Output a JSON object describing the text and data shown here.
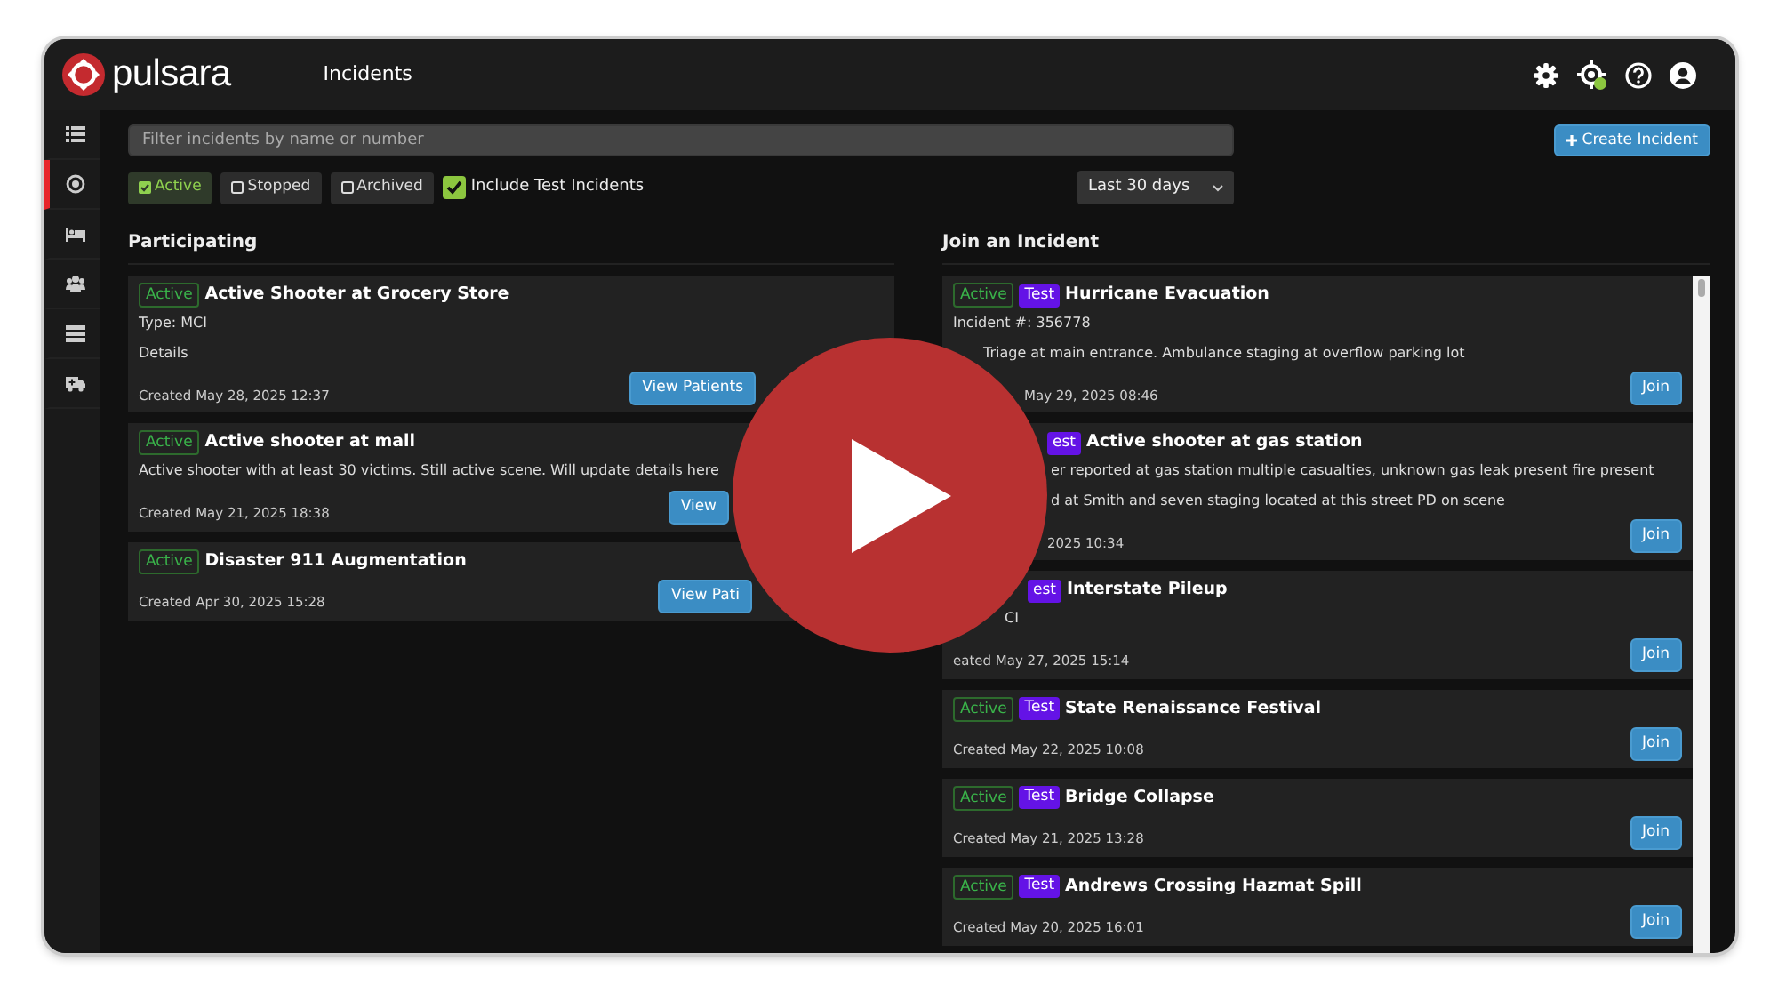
{
  "app": {
    "logo": "pulsara",
    "title": "Incidents"
  },
  "sidebar": {
    "items": [
      {
        "selected": false
      },
      {
        "selected": true
      },
      {
        "selected": false
      },
      {
        "selected": false
      },
      {
        "selected": false
      },
      {
        "selected": false
      }
    ]
  },
  "search": {
    "placeholder": "Filter incidents by name or number"
  },
  "create_button": "Create Incident",
  "filters": [
    {
      "label": "Active",
      "checked": true
    },
    {
      "label": "Stopped",
      "checked": false
    },
    {
      "label": "Archived",
      "checked": false
    }
  ],
  "include_test": {
    "label": "Include Test Incidents",
    "checked": true
  },
  "range": {
    "value": "Last 30 days"
  },
  "participating": {
    "heading": "Participating",
    "incidents": [
      {
        "badges": [
          {
            "kind": "active",
            "label": "Active"
          }
        ],
        "title": "Active Shooter at Grocery Store",
        "lines": [
          "Type: MCI",
          "Details"
        ],
        "created": "Created May 28, 2025 12:37",
        "button": "View Patients"
      },
      {
        "badges": [
          {
            "kind": "active",
            "label": "Active"
          }
        ],
        "title": "Active shooter at mall",
        "lines": [
          "Active shooter with at least 30 victims. Still active scene. Will update details here"
        ],
        "created": "Created May 21, 2025 18:38",
        "button": "View"
      },
      {
        "badges": [
          {
            "kind": "active",
            "label": "Active"
          }
        ],
        "title": "Disaster 911 Augmentation",
        "created": "Created Apr 30, 2025 15:28",
        "button": "View Pati"
      }
    ]
  },
  "join": {
    "heading": "Join an Incident",
    "incidents": [
      {
        "badges": [
          {
            "kind": "active",
            "label": "Active"
          },
          {
            "kind": "test",
            "label": "Test"
          }
        ],
        "title": "Hurricane Evacuation",
        "lines": [
          "Incident #: 356778",
          "Triage at main entrance. Ambulance staging at overflow parking lot"
        ],
        "created": "May 29, 2025 08:46",
        "button": "Join"
      },
      {
        "badges": [
          {
            "kind": "test",
            "label": "est"
          }
        ],
        "title": "Active shooter at gas station",
        "lines": [
          "er reported at gas station multiple casualties, unknown gas leak present fire present",
          "d at Smith and seven staging located at this street PD on scene"
        ],
        "created": "2025 10:34",
        "button": "Join"
      },
      {
        "badges": [
          {
            "kind": "test",
            "label": "est"
          }
        ],
        "title": "Interstate Pileup",
        "lines": [
          "CI"
        ],
        "created": "eated May 27, 2025 15:14",
        "button": "Join"
      },
      {
        "badges": [
          {
            "kind": "active",
            "label": "Active"
          },
          {
            "kind": "test",
            "label": "Test"
          }
        ],
        "title": "State Renaissance Festival",
        "created": "Created May 22, 2025 10:08",
        "button": "Join"
      },
      {
        "badges": [
          {
            "kind": "active",
            "label": "Active"
          },
          {
            "kind": "test",
            "label": "Test"
          }
        ],
        "title": "Bridge Collapse",
        "created": "Created May 21, 2025 13:28",
        "button": "Join"
      },
      {
        "badges": [
          {
            "kind": "active",
            "label": "Active"
          },
          {
            "kind": "test",
            "label": "Test"
          }
        ],
        "title": "Andrews Crossing Hazmat Spill",
        "created": "Created May 20, 2025 16:01",
        "button": "Join"
      }
    ]
  }
}
